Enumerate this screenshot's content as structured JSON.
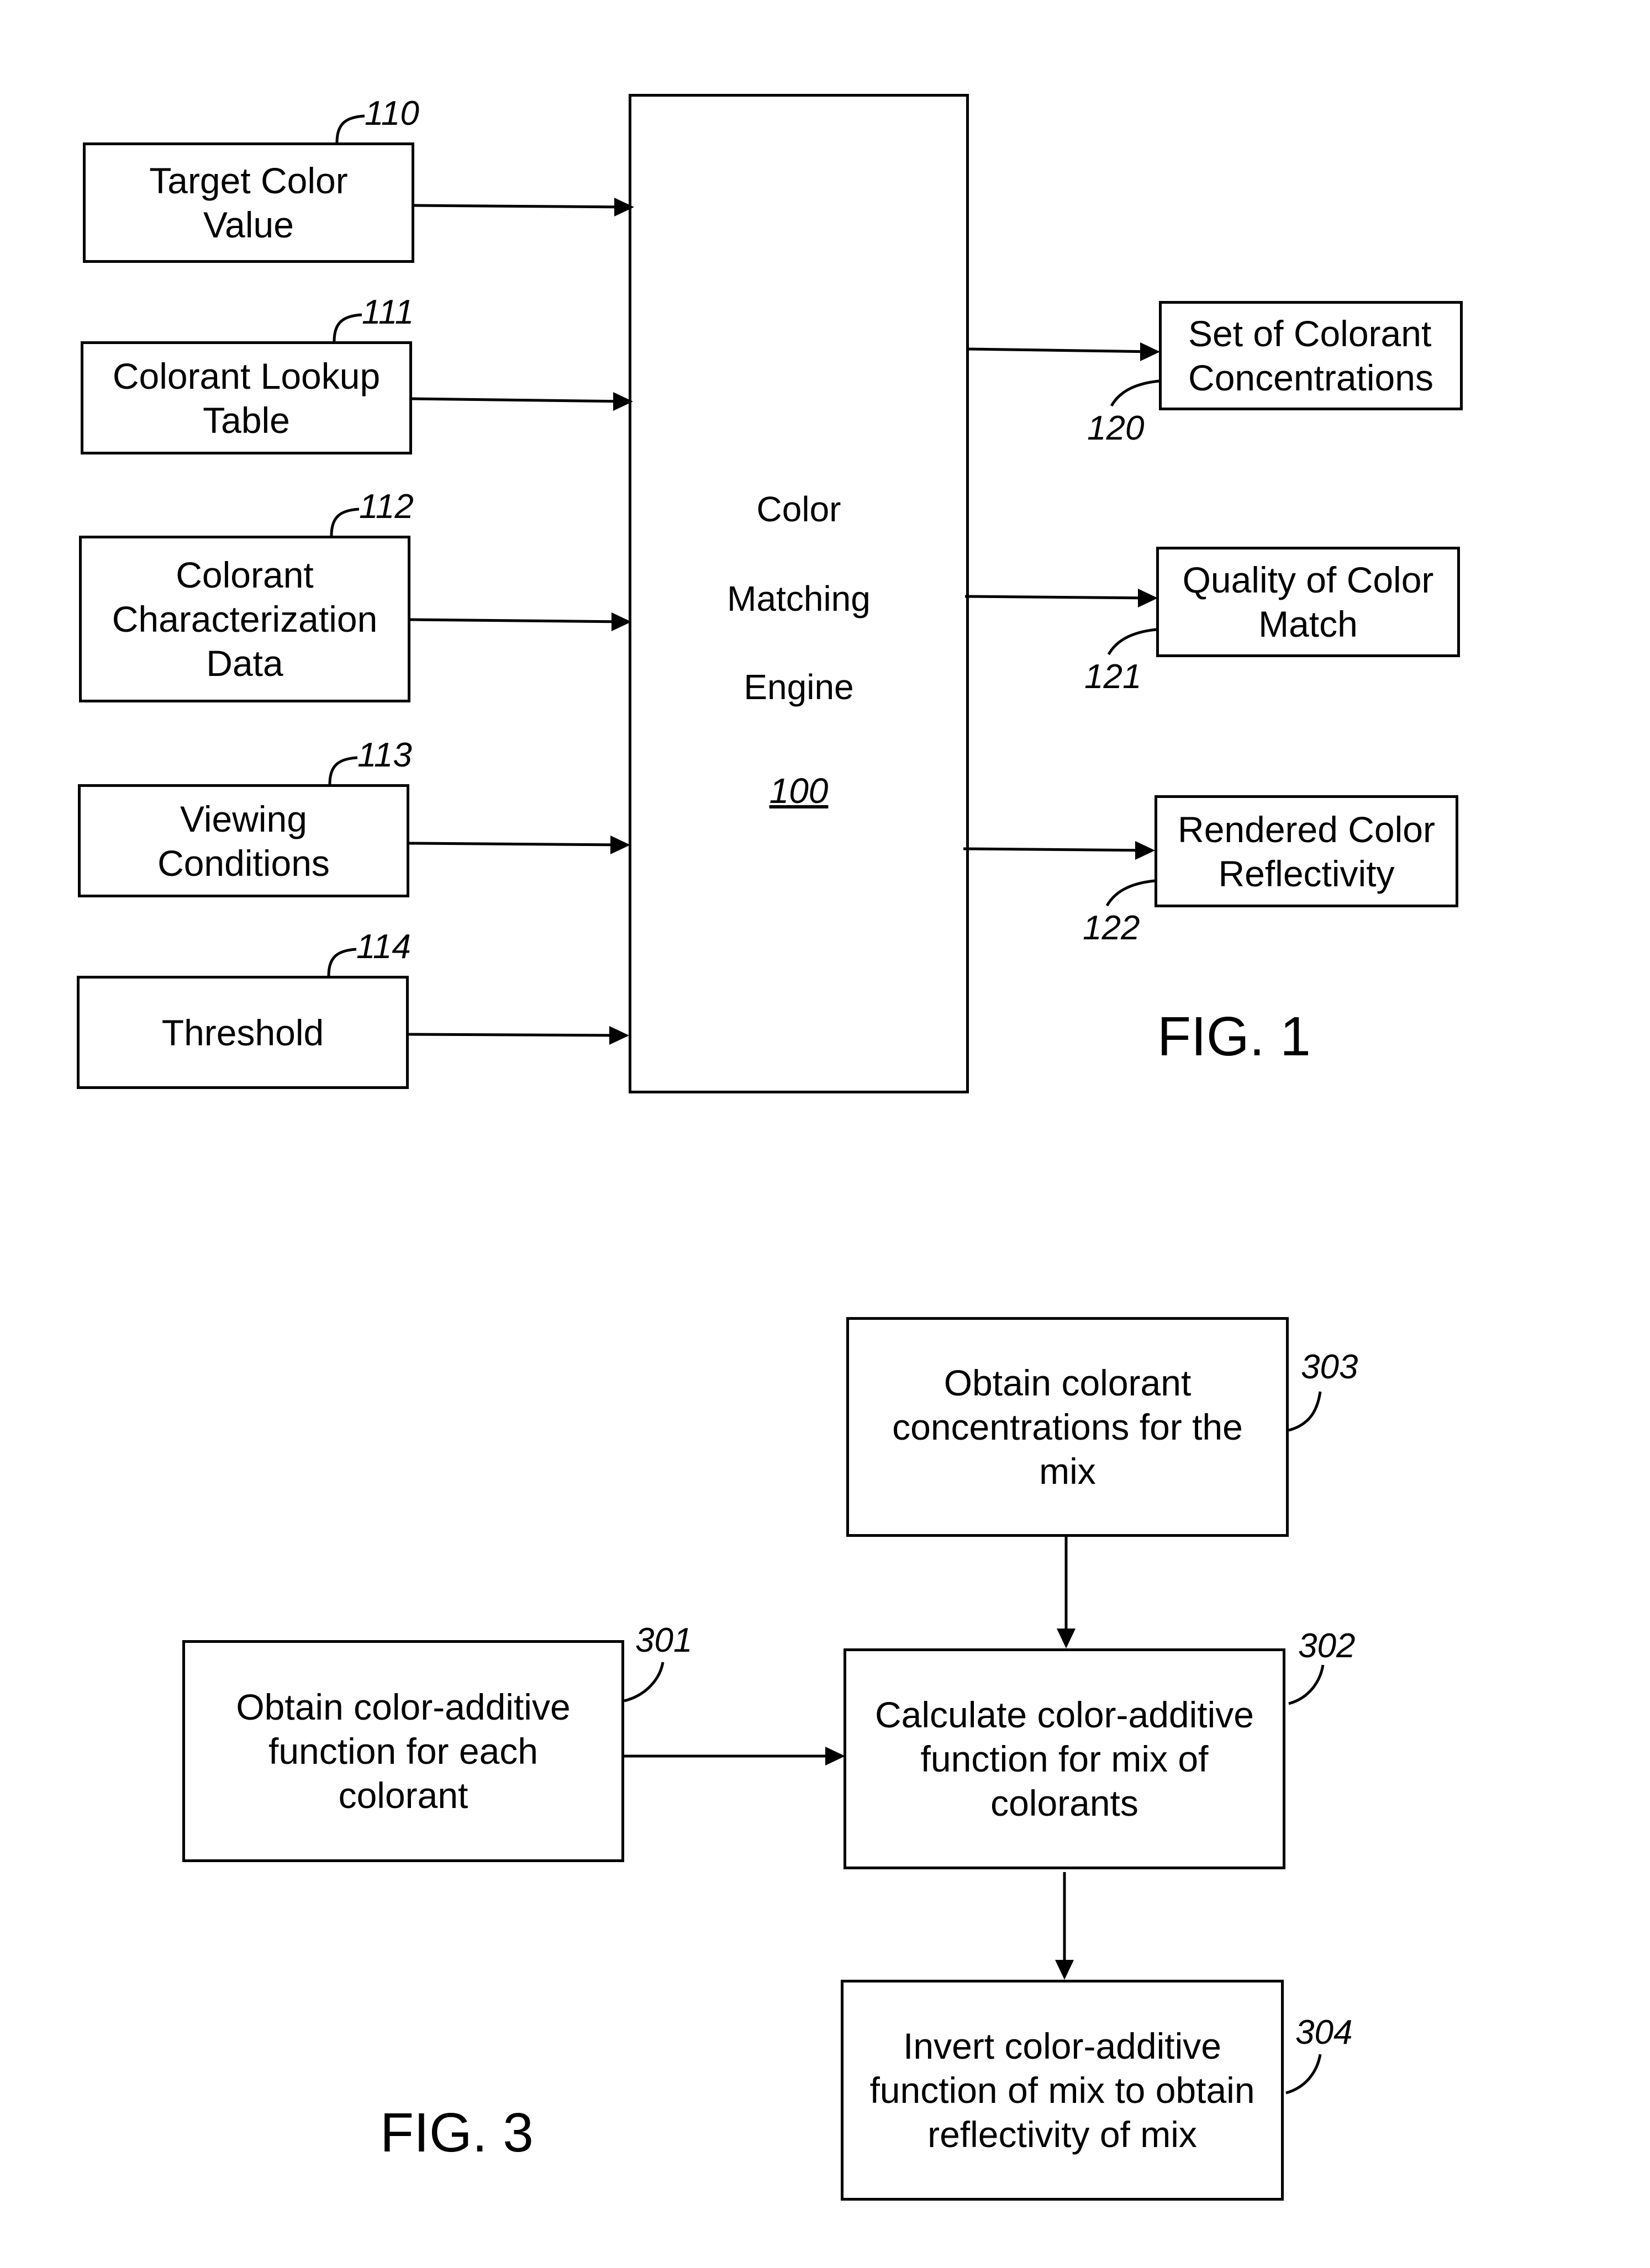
{
  "fig1": {
    "title": "FIG. 1",
    "engine": {
      "line1": "Color",
      "line2": "Matching",
      "line3": "Engine",
      "ref": "100"
    },
    "inputs": [
      {
        "label": "Target Color\nValue",
        "ref": "110"
      },
      {
        "label": "Colorant Lookup\nTable",
        "ref": "111"
      },
      {
        "label": "Colorant\nCharacterization\nData",
        "ref": "112"
      },
      {
        "label": "Viewing\nConditions",
        "ref": "113"
      },
      {
        "label": "Threshold",
        "ref": "114"
      }
    ],
    "outputs": [
      {
        "label": "Set of Colorant\nConcentrations",
        "ref": "120"
      },
      {
        "label": "Quality of Color\nMatch",
        "ref": "121"
      },
      {
        "label": "Rendered Color\nReflectivity",
        "ref": "122"
      }
    ]
  },
  "fig3": {
    "title": "FIG. 3",
    "steps": [
      {
        "label": "Obtain color-additive\nfunction for each\ncolorant",
        "ref": "301"
      },
      {
        "label": "Calculate color-additive\nfunction for mix of\ncolorants",
        "ref": "302"
      },
      {
        "label": "Obtain colorant\nconcentrations for the\nmix",
        "ref": "303"
      },
      {
        "label": "Invert color-additive\nfunction of mix to obtain\nreflectivity of mix",
        "ref": "304"
      }
    ]
  }
}
